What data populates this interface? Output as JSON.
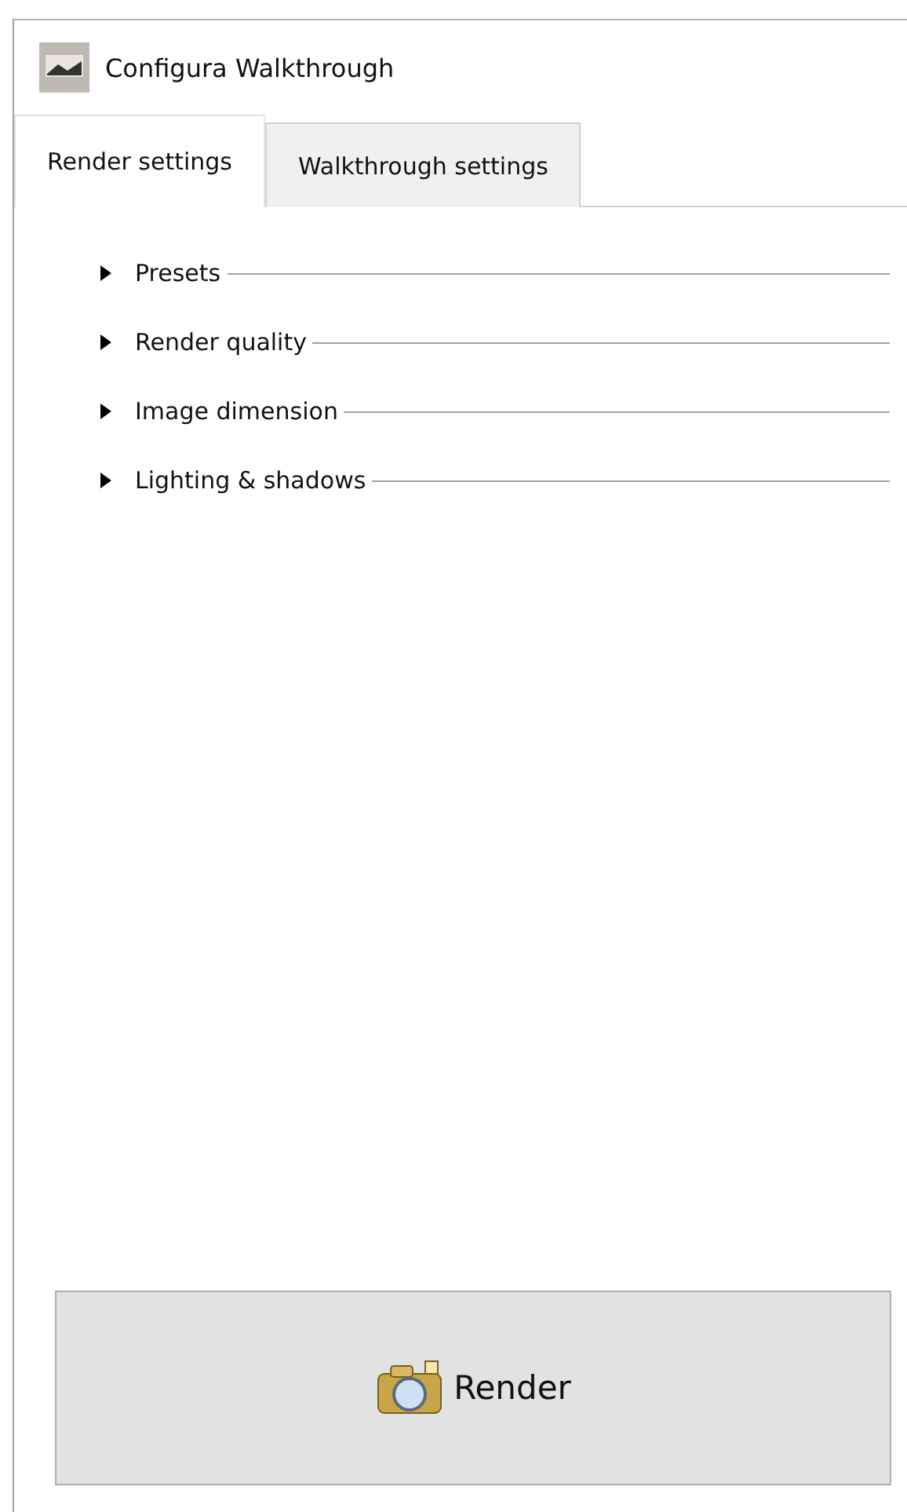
{
  "window": {
    "title": "Configura Walkthrough"
  },
  "tabs": [
    {
      "label": "Render settings",
      "selected": true
    },
    {
      "label": "Walkthrough settings",
      "selected": false
    }
  ],
  "sections": [
    {
      "label": "Presets",
      "expanded": false
    },
    {
      "label": "Render quality",
      "expanded": false
    },
    {
      "label": "Image dimension",
      "expanded": false
    },
    {
      "label": "Lighting & shadows",
      "expanded": false
    }
  ],
  "render_button": {
    "label": "Render"
  }
}
